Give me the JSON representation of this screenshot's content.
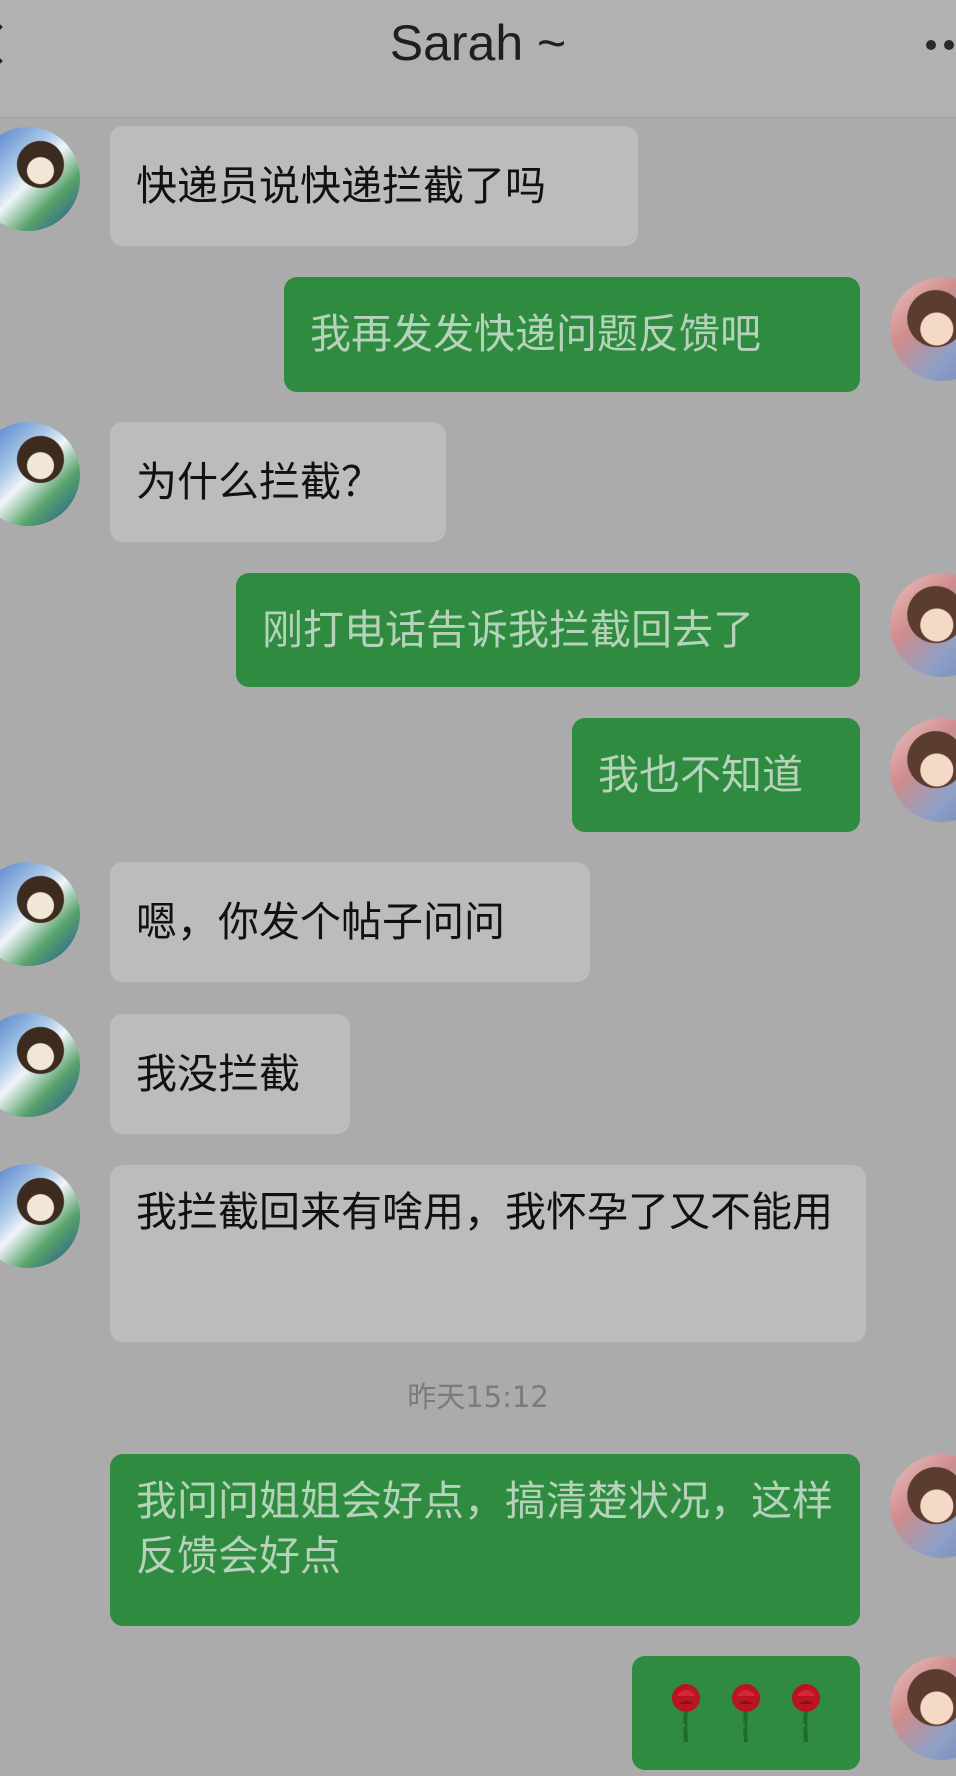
{
  "header": {
    "title": "Sarah ~"
  },
  "messages": [
    {
      "sender": "other",
      "text": "快递员说快递拦截了吗"
    },
    {
      "sender": "self",
      "text": "我再发发快递问题反馈吧"
    },
    {
      "sender": "other",
      "text": "为什么拦截？"
    },
    {
      "sender": "self",
      "text": "刚打电话告诉我拦截回去了"
    },
    {
      "sender": "self",
      "text": "我也不知道"
    },
    {
      "sender": "other",
      "text": "嗯，你发个帖子问问"
    },
    {
      "sender": "other",
      "text": "我没拦截"
    },
    {
      "sender": "other",
      "text": "我拦截回来有啥用，我怀孕了又不能用"
    },
    {
      "sender": "self",
      "text": "我问问姐姐会好点，搞清楚状况，这样反馈会好点"
    },
    {
      "sender": "self",
      "type": "emoji",
      "emoji": [
        "rose",
        "rose",
        "rose"
      ]
    }
  ],
  "timestamp": "昨天15:12",
  "colors": {
    "background": "#ababab",
    "header": "#b1b1b1",
    "incoming_bubble": "#bcbcbc",
    "outgoing_bubble": "#2f8b3f",
    "outgoing_text": "#b6d2bb"
  }
}
